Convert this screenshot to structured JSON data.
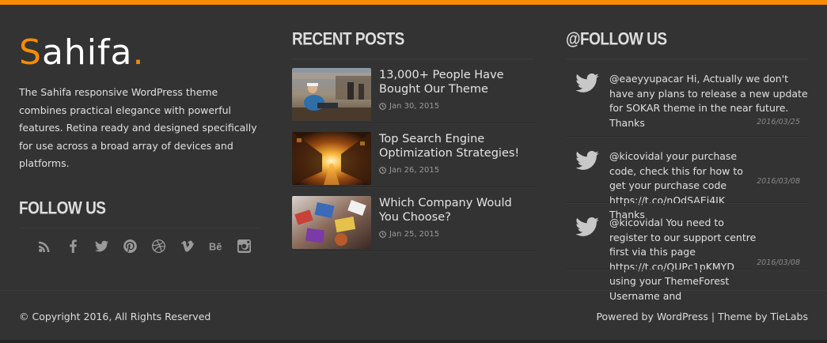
{
  "brand": {
    "logo_first": "S",
    "logo_rest": "ahifa",
    "logo_dot": ".",
    "accent": "#f88c00"
  },
  "about": {
    "text": "The Sahifa responsive WordPress theme combines practical elegance with powerful features. Retina ready and designed specifically for use across a broad array of devices and platforms."
  },
  "follow": {
    "title": "Follow us",
    "icons": [
      "rss-icon",
      "facebook-icon",
      "twitter-icon",
      "pinterest-icon",
      "dribbble-icon",
      "vimeo-icon",
      "behance-icon",
      "instagram-icon"
    ]
  },
  "recent_posts": {
    "title": "Recent Posts",
    "items": [
      {
        "title": "13,000+ People Have Bought Our Theme",
        "date": "Jan 30, 2015"
      },
      {
        "title": "Top Search Engine Optimization Strategies!",
        "date": "Jan 26, 2015"
      },
      {
        "title": "Which Company Would You Choose?",
        "date": "Jan 25, 2015"
      }
    ]
  },
  "twitter": {
    "title": "@Follow Us",
    "tweets": [
      {
        "text": "@eaeyyupacar Hi, Actually we don't have any plans to release a new update for SOKAR theme in the near future. Thanks",
        "time": "2016/03/25"
      },
      {
        "text": "@kicovidal your purchase code, check this for how to get your purchase code https://t.co/nOdSAEi4IK Thanks",
        "time": "2016/03/08"
      },
      {
        "text": "@kicovidal You need to register to our support centre first via this page https://t.co/QUPc1pKMYD using your ThemeForest Username and",
        "time": "2016/03/08"
      }
    ]
  },
  "footer": {
    "copyright": "© Copyright 2016, All Rights Reserved",
    "powered": "Powered by WordPress",
    "separator": "|",
    "theme_by": "Theme by TieLabs"
  }
}
